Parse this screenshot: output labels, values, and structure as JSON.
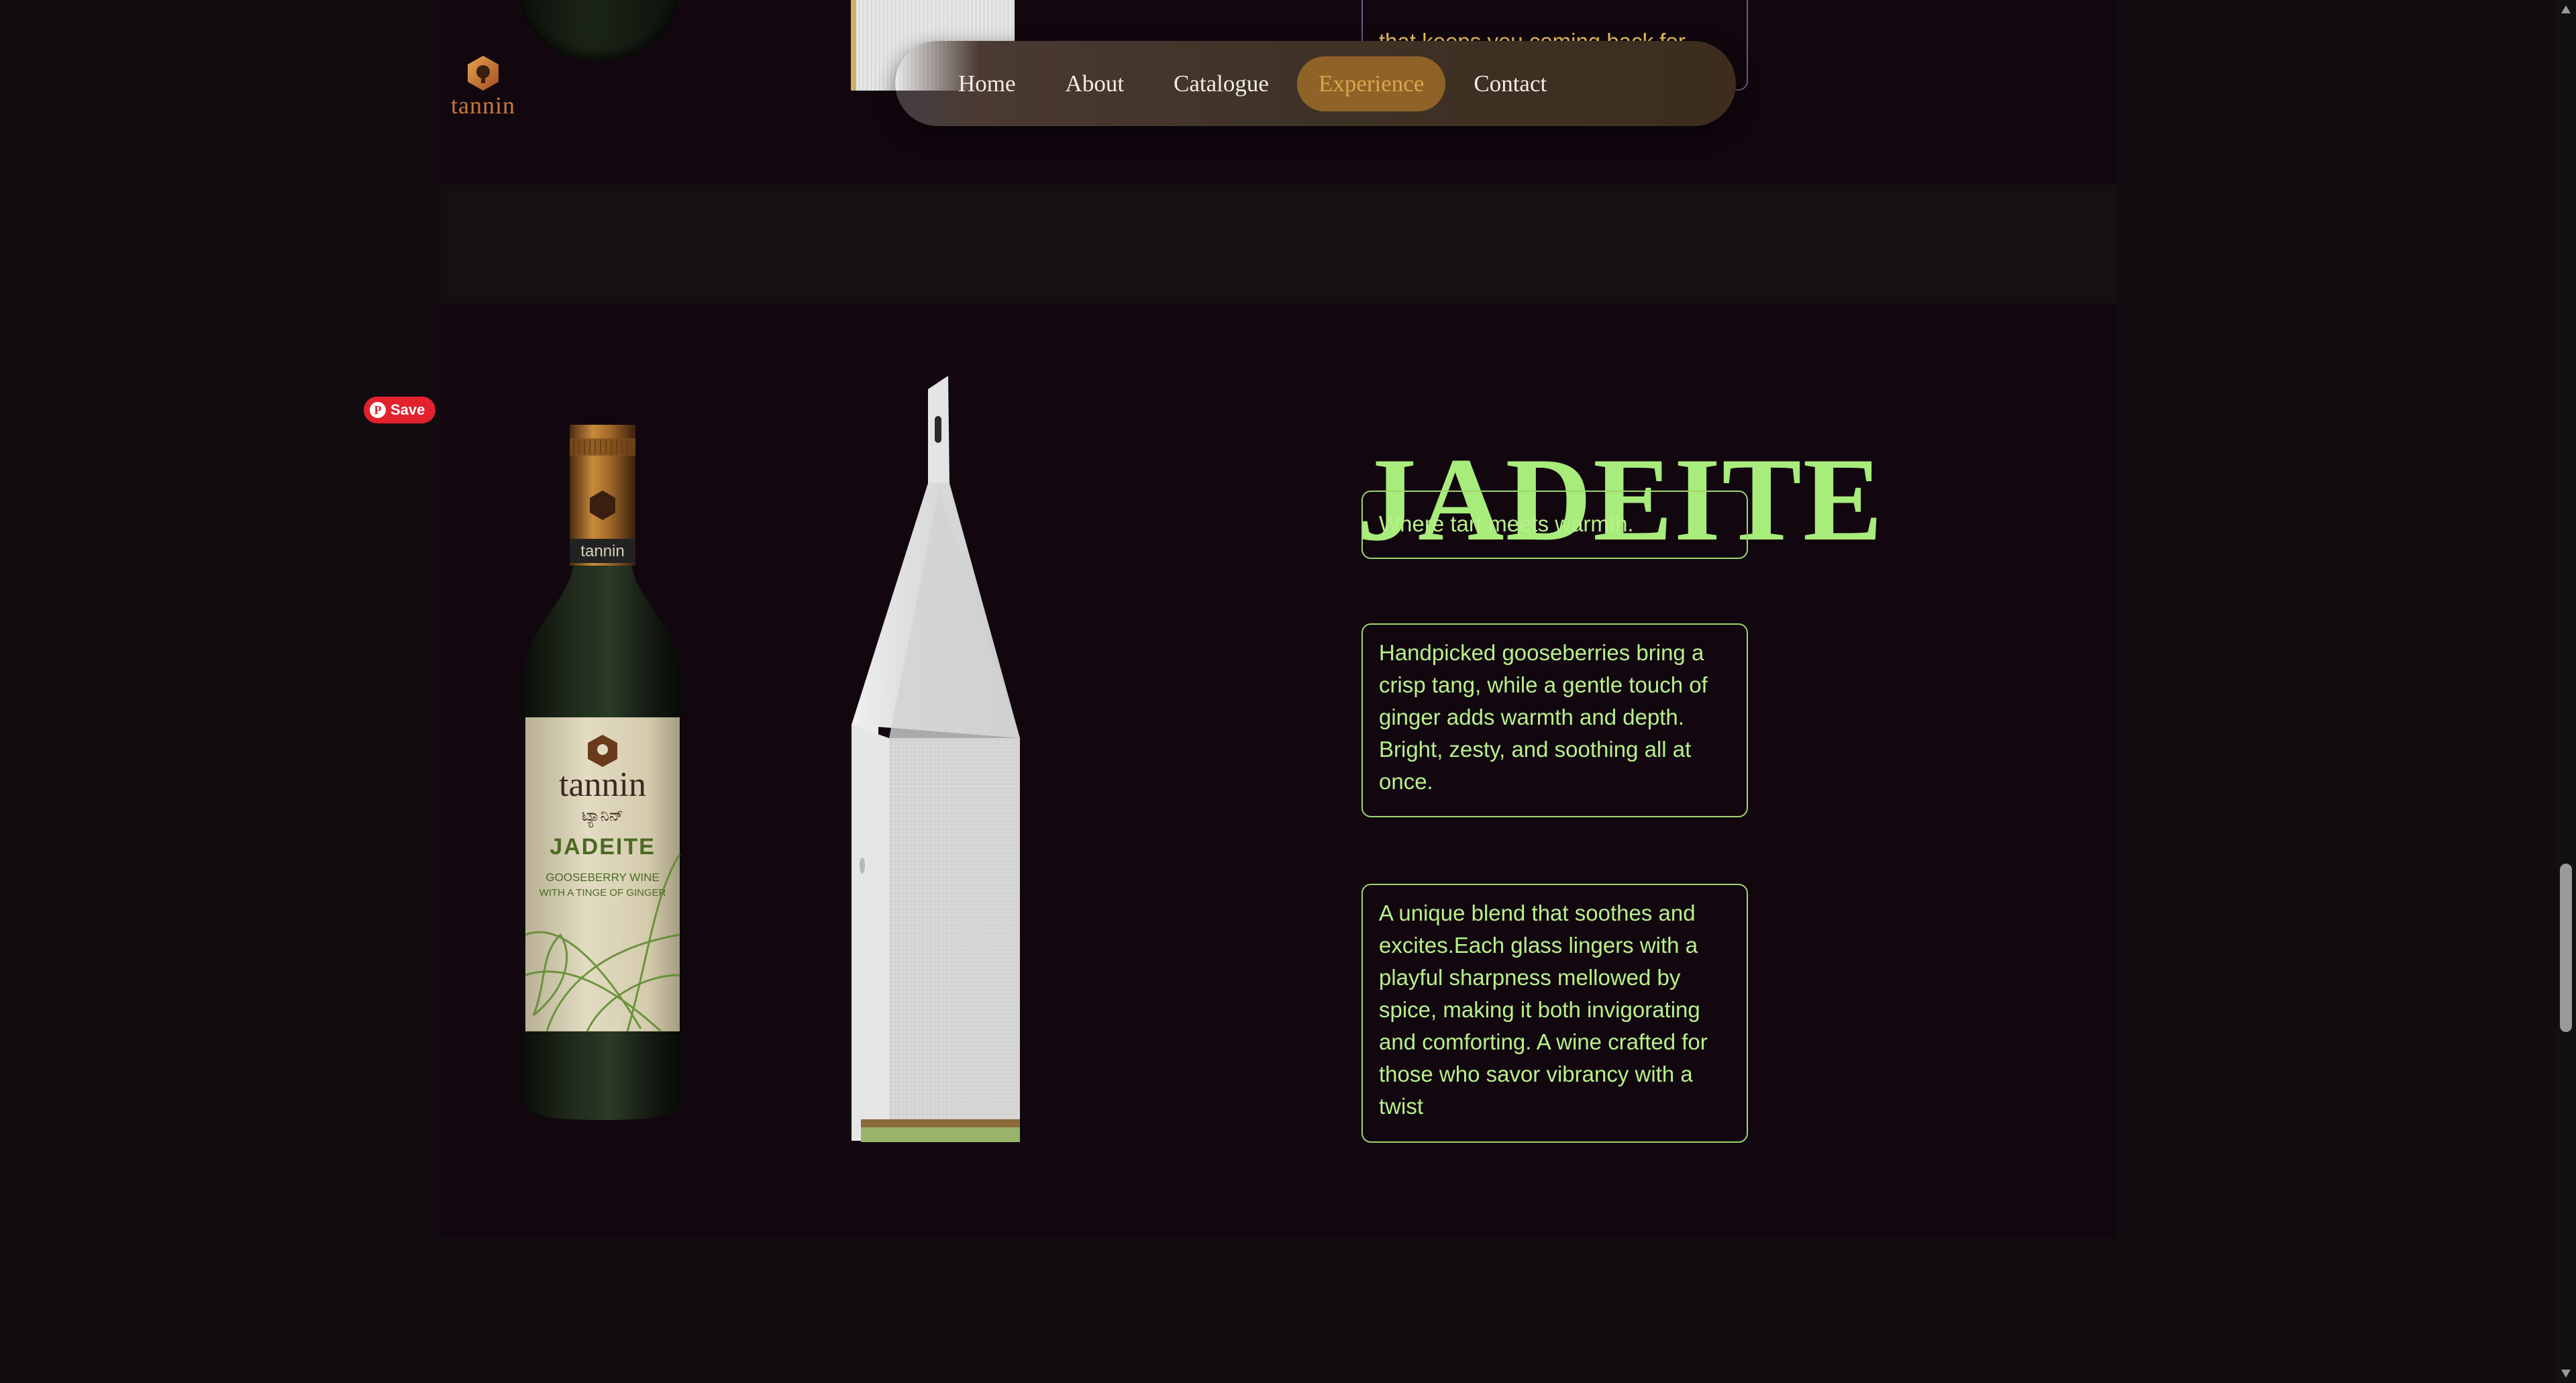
{
  "logo": {
    "text": "tannin"
  },
  "nav": {
    "items": [
      {
        "label": "Home"
      },
      {
        "label": "About"
      },
      {
        "label": "Catalogue"
      },
      {
        "label": "Experience"
      },
      {
        "label": "Contact"
      }
    ],
    "active": "Experience"
  },
  "previous_section": {
    "card_text": "that keeps you coming back for"
  },
  "pinterest": {
    "save_label": "Save"
  },
  "product": {
    "name": "JADEITE",
    "tagline": "Where tart meets warmth.",
    "description": "Handpicked gooseberries bring a crisp tang, while a gentle touch of ginger adds warmth and depth. Bright, zesty, and soothing all at once.",
    "details": "A unique blend that soothes and excites.Each glass lingers with a playful sharpness mellowed by spice, making it both invigorating and comforting. A wine crafted for those who savor vibrancy with a twist",
    "label": {
      "brand": "tannin",
      "brand_kannada": "ಟ್ಯಾನಿನ್",
      "name": "JADEITE",
      "subtitle_line1": "GOOSEBERRY WINE",
      "subtitle_line2": "WITH A TINGE OF GINGER",
      "neck_text": "tannin"
    }
  },
  "colors": {
    "accent_green": "#a8ec7c",
    "nav_active": "#8f6328",
    "logo_copper": "#c77a3a",
    "background": "#12070f"
  }
}
